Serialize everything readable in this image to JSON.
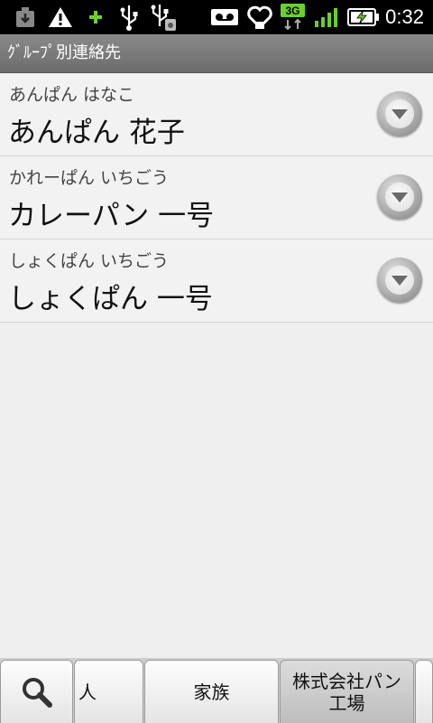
{
  "status_bar": {
    "time": "0:32",
    "network": "3G",
    "icons": [
      "download-icon",
      "warning-icon",
      "plus-icon",
      "usb-icon",
      "usb-storage-icon",
      "voicemail-icon",
      "heart-icon",
      "3g-icon",
      "signal-icon",
      "battery-charging-icon"
    ]
  },
  "header": {
    "title": "ｸﾞﾙｰﾌﾟ別連絡先"
  },
  "contacts": [
    {
      "kana": "あんぱん はなこ",
      "name": "あんぱん 花子"
    },
    {
      "kana": "かれーぱん いちごう",
      "name": "カレーパン 一号"
    },
    {
      "kana": "しょくぱん いちごう",
      "name": "しょくぱん 一号"
    }
  ],
  "tabs": {
    "search_icon": "search-icon",
    "items": [
      {
        "label": "人"
      },
      {
        "label": "家族"
      },
      {
        "label": "株式会社パン工場"
      }
    ]
  }
}
